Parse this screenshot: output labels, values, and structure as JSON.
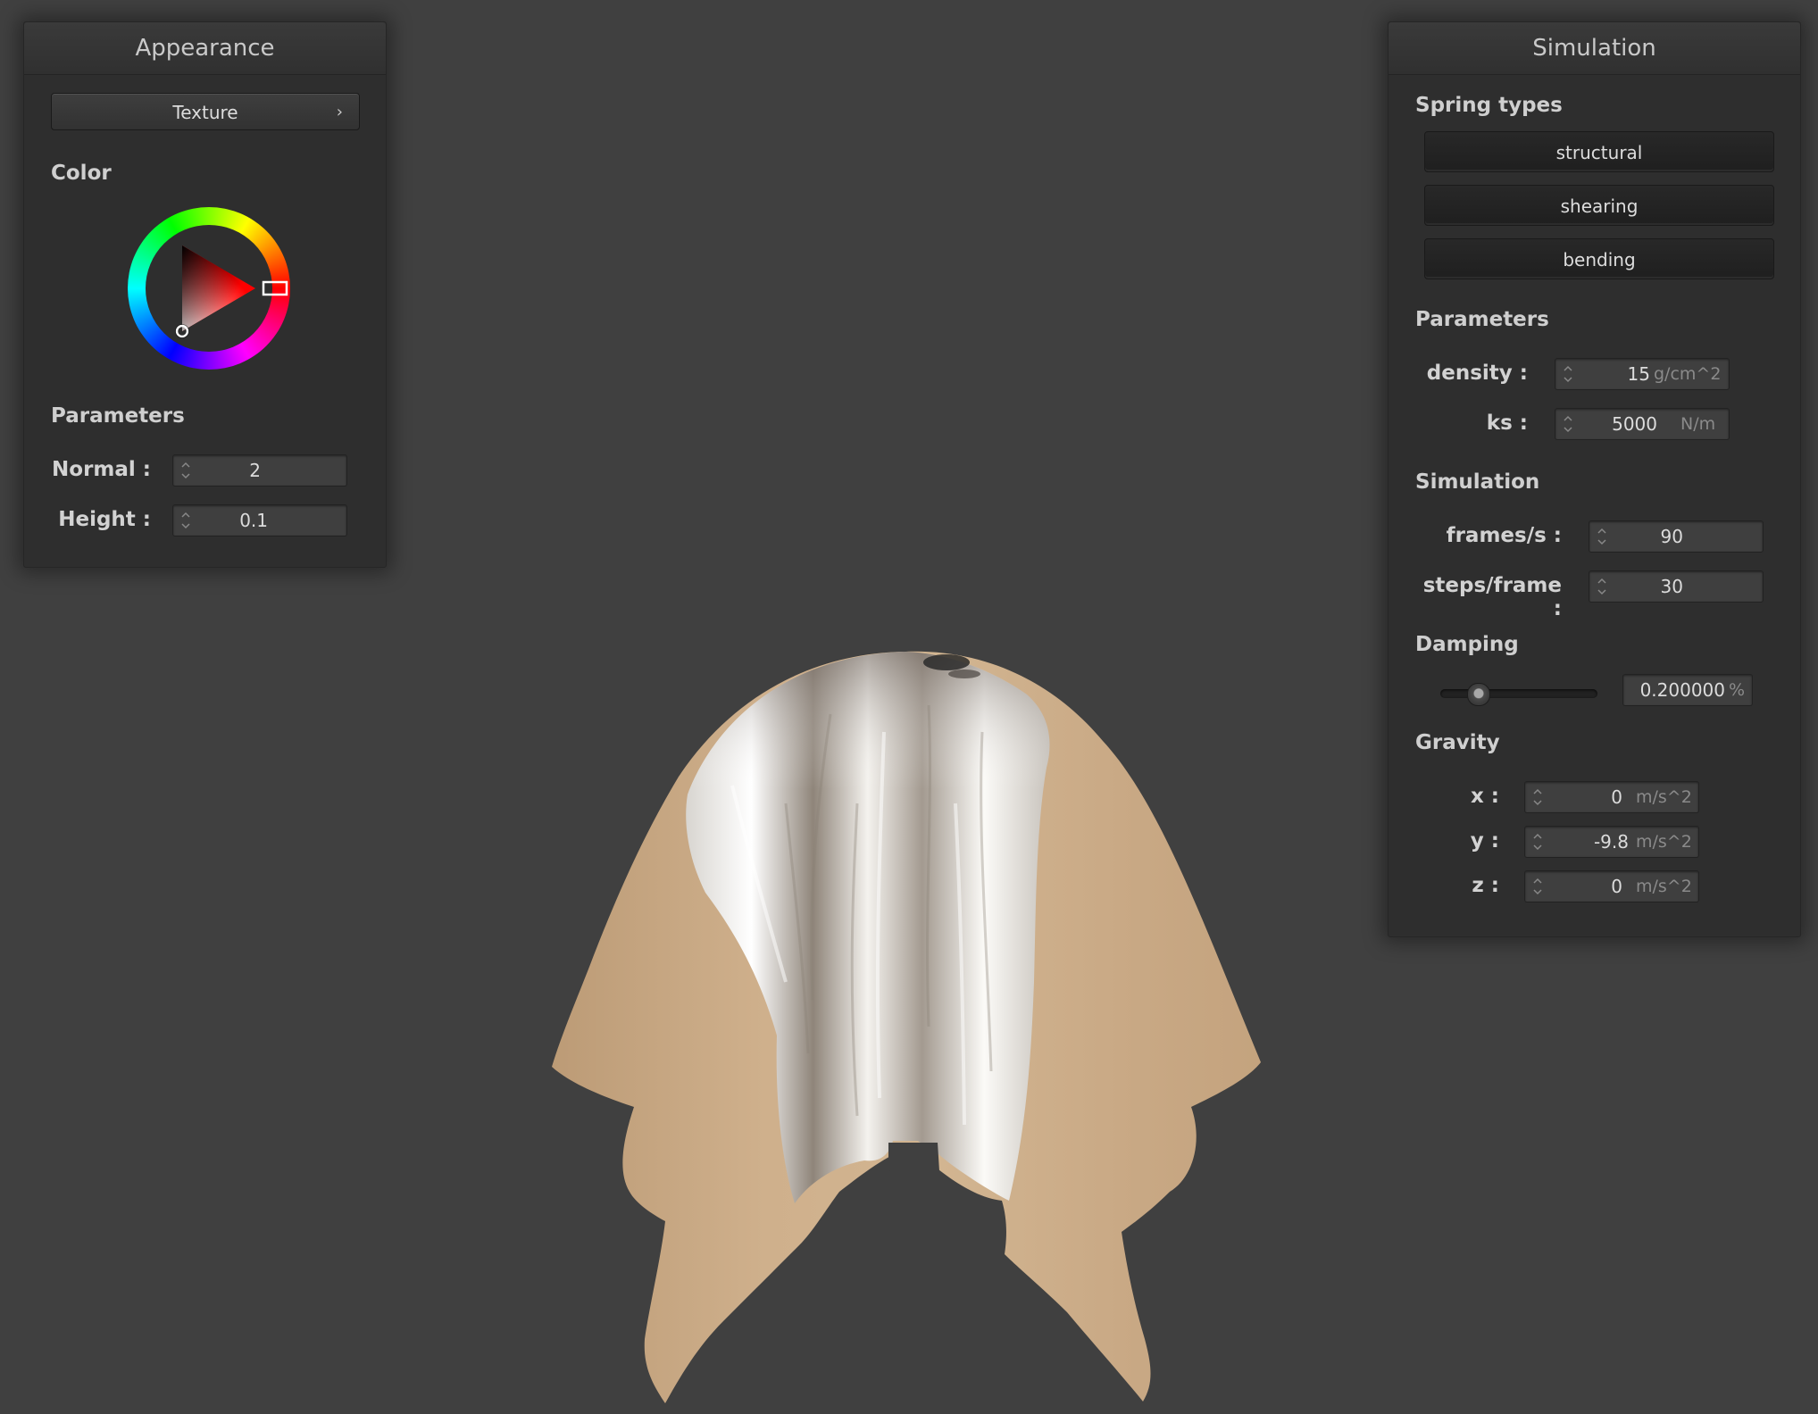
{
  "appearance": {
    "title": "Appearance",
    "texture_button": "Texture",
    "texture_chevron": "›",
    "color_label": "Color",
    "selected_hue": "#ff0000",
    "parameters_label": "Parameters",
    "normal": {
      "label": "Normal :",
      "value": "2"
    },
    "height": {
      "label": "Height :",
      "value": "0.1"
    }
  },
  "simulation": {
    "title": "Simulation",
    "spring_types_label": "Spring types",
    "spring_types": [
      "structural",
      "shearing",
      "bending"
    ],
    "parameters_label": "Parameters",
    "density": {
      "label": "density :",
      "value": "15",
      "unit": "g/cm^2"
    },
    "ks": {
      "label": "ks :",
      "value": "5000",
      "unit": "N/m"
    },
    "simulation_label": "Simulation",
    "frames": {
      "label": "frames/s :",
      "value": "90"
    },
    "steps": {
      "label": "steps/frame :",
      "value": "30"
    },
    "damping_label": "Damping",
    "damping": {
      "value": "0.200000",
      "unit": "%",
      "slider_level": 0.2
    },
    "gravity_label": "Gravity",
    "gravity": {
      "x": {
        "label": "x :",
        "value": "0",
        "unit": "m/s^2"
      },
      "y": {
        "label": "y :",
        "value": "-9.8",
        "unit": "m/s^2"
      },
      "z": {
        "label": "z :",
        "value": "0",
        "unit": "m/s^2"
      }
    }
  },
  "viewport": {
    "background": "#404040",
    "cloth_color": "#c9aa85",
    "texture_subject": "white-fluffy-dog-fur"
  }
}
